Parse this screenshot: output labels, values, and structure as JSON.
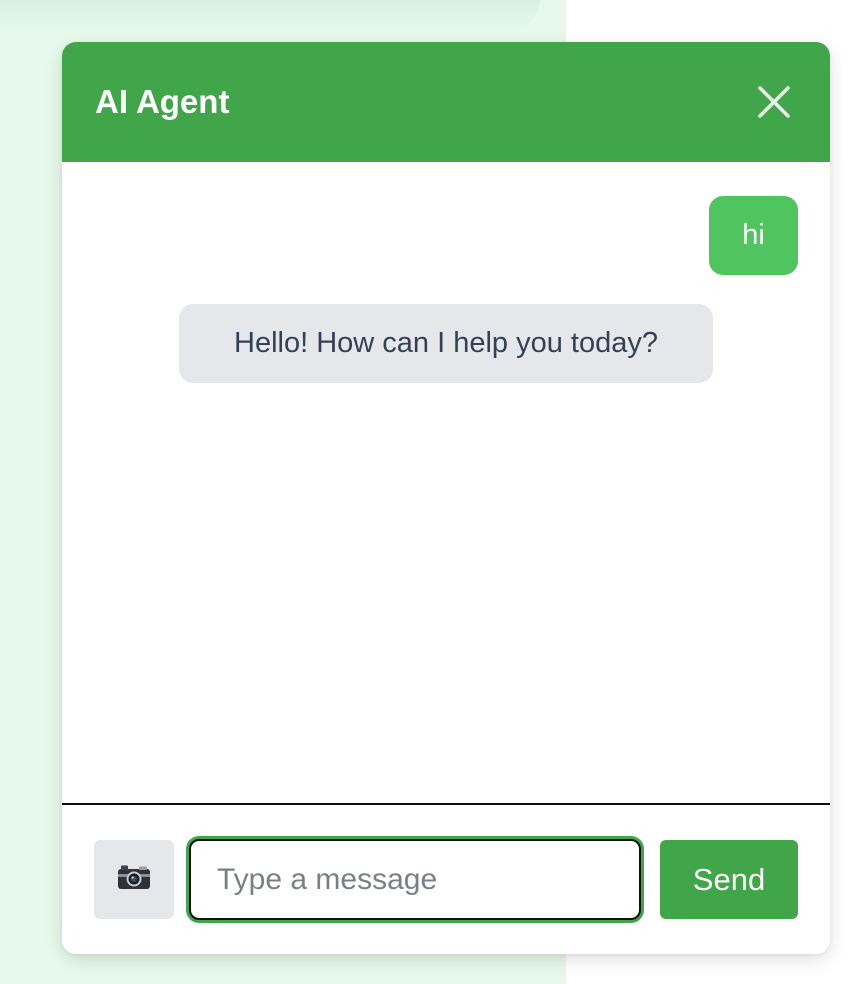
{
  "colors": {
    "header_bg": "#41a54a",
    "user_bubble_bg": "#4fc45f",
    "agent_bubble_bg": "#e5e7eb",
    "page_bg": "#e6f9ea",
    "send_button_bg": "#41a54a"
  },
  "header": {
    "title": "AI Agent",
    "close_icon": "close-icon"
  },
  "messages": [
    {
      "sender": "user",
      "text": "hi"
    },
    {
      "sender": "agent",
      "text": "Hello! How can I help you today?"
    }
  ],
  "composer": {
    "camera_icon": "camera-icon",
    "input_value": "",
    "input_placeholder": "Type a message",
    "send_label": "Send"
  }
}
